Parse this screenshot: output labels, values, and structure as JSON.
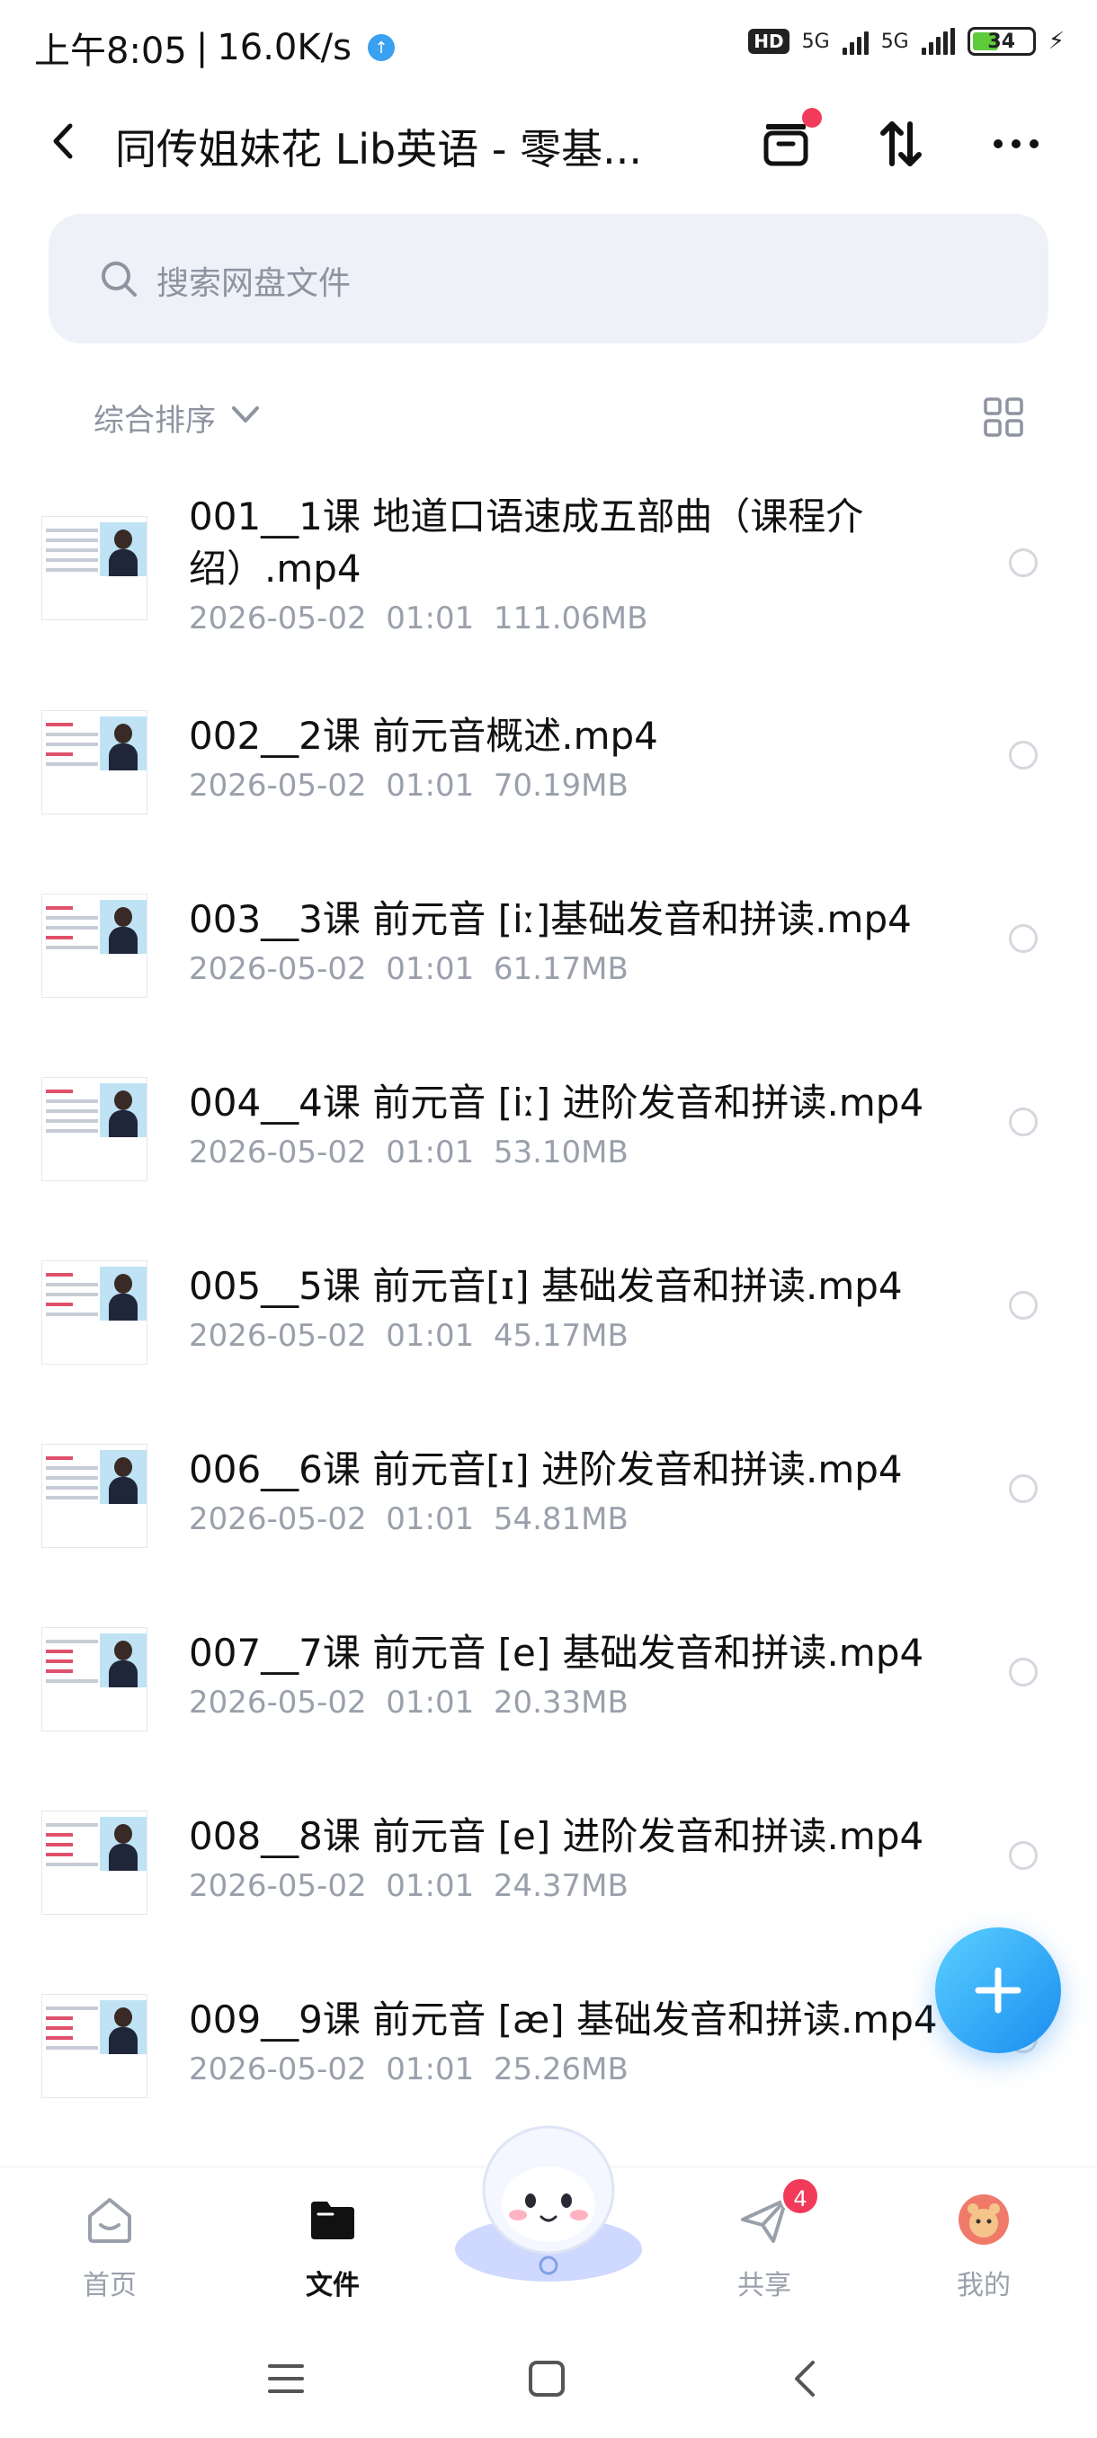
{
  "status_bar": {
    "time": "上午8:05",
    "speed": "16.0K/s",
    "hd_label": "HD",
    "net1": "5G",
    "net2": "5G",
    "battery": "34"
  },
  "header": {
    "title": "同传姐妹花 Lib英语 - 零基..."
  },
  "search": {
    "placeholder": "搜索网盘文件"
  },
  "sort": {
    "label": "综合排序"
  },
  "files": [
    {
      "name": "001__1课 地道口语速成五部曲（课程介绍）.mp4",
      "date": "2026-05-02",
      "time": "01:01",
      "size": "111.06MB"
    },
    {
      "name": "002__2课 前元音概述.mp4",
      "date": "2026-05-02",
      "time": "01:01",
      "size": "70.19MB"
    },
    {
      "name": "003__3课 前元音 [iː]基础发音和拼读.mp4",
      "date": "2026-05-02",
      "time": "01:01",
      "size": "61.17MB"
    },
    {
      "name": "004__4课 前元音 [iː] 进阶发音和拼读.mp4",
      "date": "2026-05-02",
      "time": "01:01",
      "size": "53.10MB"
    },
    {
      "name": "005__5课 前元音[ɪ] 基础发音和拼读.mp4",
      "date": "2026-05-02",
      "time": "01:01",
      "size": "45.17MB"
    },
    {
      "name": "006__6课 前元音[ɪ] 进阶发音和拼读.mp4",
      "date": "2026-05-02",
      "time": "01:01",
      "size": "54.81MB"
    },
    {
      "name": "007__7课 前元音 [e] 基础发音和拼读.mp4",
      "date": "2026-05-02",
      "time": "01:01",
      "size": "20.33MB"
    },
    {
      "name": "008__8课 前元音 [e] 进阶发音和拼读.mp4",
      "date": "2026-05-02",
      "time": "01:01",
      "size": "24.37MB"
    },
    {
      "name": "009__9课 前元音 [æ] 基础发音和拼读.mp4",
      "date": "2026-05-02",
      "time": "01:01",
      "size": "25.26MB"
    }
  ],
  "tabs": [
    {
      "label": "首页"
    },
    {
      "label": "文件"
    },
    {
      "label": "共享",
      "badge": "4"
    },
    {
      "label": "我的"
    }
  ],
  "colors": {
    "accent": "#1a8cf0",
    "badge": "#f23a5b",
    "meta_text": "#9aa0ab"
  }
}
